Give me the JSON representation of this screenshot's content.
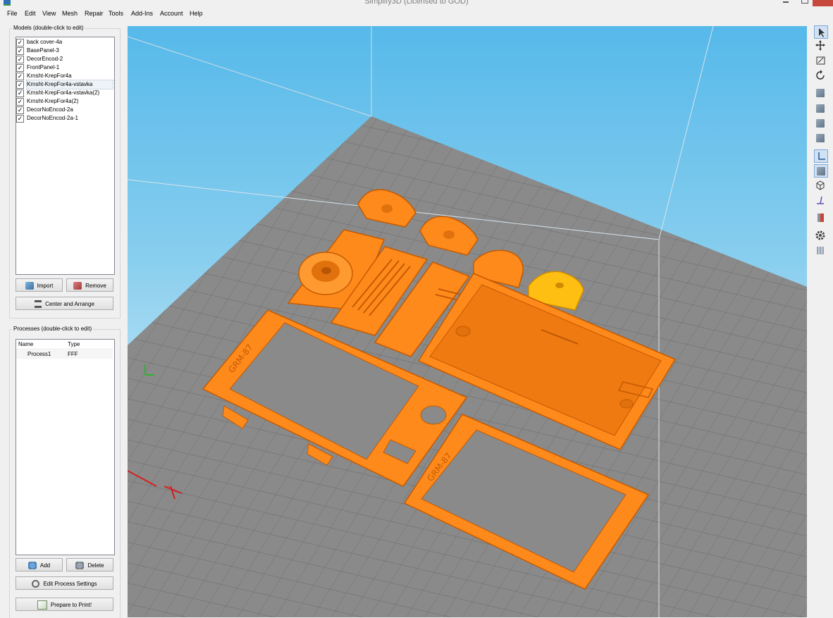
{
  "window": {
    "title": "Simplify3D (Licensed to GOD)"
  },
  "menu": [
    "File",
    "Edit",
    "View",
    "Mesh",
    "Repair",
    "Tools",
    "Add-Ins",
    "Account",
    "Help"
  ],
  "models_panel": {
    "label": "Models (double-click to edit)",
    "items": [
      {
        "name": "back cover-4a",
        "checked": true
      },
      {
        "name": "BasePanel-3",
        "checked": true
      },
      {
        "name": "DecorEncod-2",
        "checked": true
      },
      {
        "name": "FrontPanel-1",
        "checked": true
      },
      {
        "name": "Krnsht-KrepFor4a",
        "checked": true
      },
      {
        "name": "Krnsht-KrepFor4a-vstavka",
        "checked": true,
        "selected": true
      },
      {
        "name": "Krnsht-KrepFor4a-vstavka(2)",
        "checked": true
      },
      {
        "name": "Krnsht-KrepFor4a(2)",
        "checked": true
      },
      {
        "name": "DecorNoEncod-2a",
        "checked": true
      },
      {
        "name": "DecorNoEncod-2a-1",
        "checked": true
      }
    ],
    "import_label": "Import",
    "remove_label": "Remove",
    "center_label": "Center and Arrange"
  },
  "processes_panel": {
    "label": "Processes (double-click to edit)",
    "columns": [
      "Name",
      "Type"
    ],
    "rows": [
      {
        "name": "Process1",
        "type": "FFF"
      }
    ],
    "add_label": "Add",
    "delete_label": "Delete",
    "edit_label": "Edit Process Settings",
    "prepare_label": "Prepare to Print!"
  },
  "viewport": {
    "labels": [
      "GRM-87",
      "GRM-87"
    ],
    "colors": {
      "part": "#ff8a1c",
      "selected_part": "#ffbf12",
      "bed": "#8a8a8a",
      "grid_line": "#6d6d6d"
    }
  },
  "right_toolbar": [
    "select-icon",
    "move-icon",
    "scale-icon",
    "rotate-icon",
    "view-default-icon",
    "view-front-icon",
    "view-left-icon",
    "view-right-icon",
    "axes-toggle-icon",
    "solid-view-icon",
    "wireframe-view-icon",
    "normals-icon",
    "cross-section-icon",
    "settings-gear-icon",
    "build-volume-icon"
  ]
}
